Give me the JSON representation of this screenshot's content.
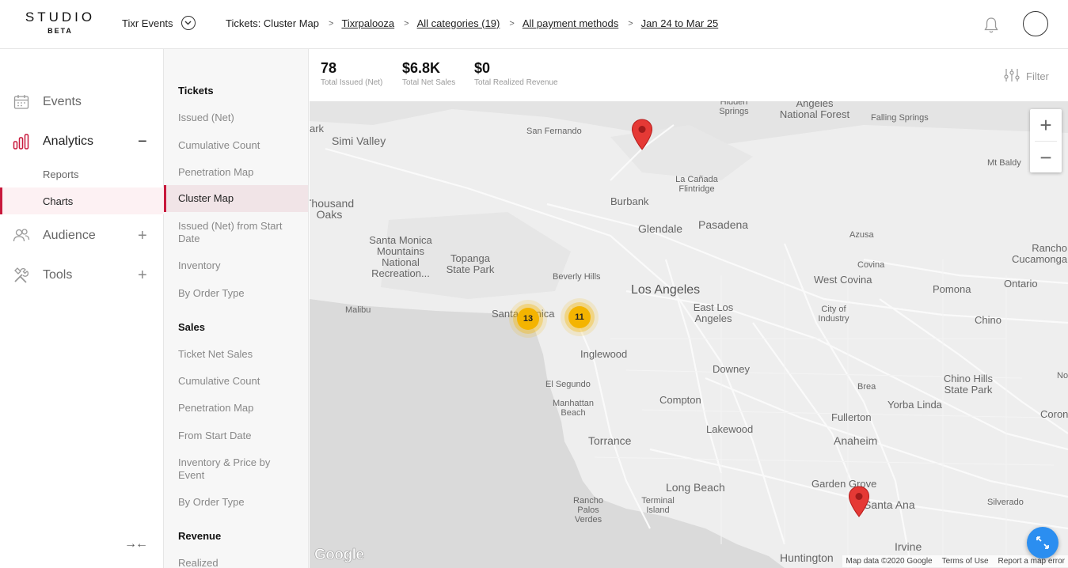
{
  "logo": {
    "main": "STUDIO",
    "sub": "BETA"
  },
  "org": {
    "name": "Tixr Events"
  },
  "breadcrumbs": {
    "current": "Tickets: Cluster Map",
    "links": [
      "Tixrpalooza",
      "All categories (19)",
      "All payment methods",
      "Jan 24 to Mar 25"
    ],
    "separator": ">"
  },
  "leftnav": {
    "events": "Events",
    "analytics": "Analytics",
    "analytics_toggle": "−",
    "reports": "Reports",
    "charts": "Charts",
    "audience": "Audience",
    "audience_toggle": "+",
    "tools": "Tools",
    "tools_toggle": "+",
    "collapse": "→←"
  },
  "midnav": {
    "tickets_heading": "Tickets",
    "tickets": [
      "Issued (Net)",
      "Cumulative Count",
      "Penetration Map",
      "Cluster Map",
      "Issued (Net) from Start Date",
      "Inventory",
      "By Order Type"
    ],
    "sales_heading": "Sales",
    "sales": [
      "Ticket Net Sales",
      "Cumulative Count",
      "Penetration Map",
      "From Start Date",
      "Inventory & Price by Event",
      "By Order Type"
    ],
    "revenue_heading": "Revenue",
    "revenue": [
      "Realized"
    ]
  },
  "stats": [
    {
      "value": "78",
      "label": "Total Issued (Net)"
    },
    {
      "value": "$6.8K",
      "label": "Total Net Sales"
    },
    {
      "value": "$0",
      "label": "Total Realized Revenue"
    }
  ],
  "filter": {
    "label": "Filter"
  },
  "map": {
    "places": [
      "Simi Valley",
      "San Fernando",
      "Hidden Springs",
      "Angeles National Forest",
      "Falling Springs",
      "Mt Baldy",
      "La Cañada Flintridge",
      "Burbank",
      "Glendale",
      "Pasadena",
      "Azusa",
      "Rancho Cucamonga",
      "Thousand Oaks",
      "Santa Monica Mountains National Recreation...",
      "Topanga State Park",
      "Covina",
      "West Covina",
      "Pomona",
      "Ontario",
      "Beverly Hills",
      "Los Angeles",
      "East Los Angeles",
      "City of Industry",
      "Malibu",
      "Santa Monica",
      "Chino",
      "Inglewood",
      "Downey",
      "El Segundo",
      "Manhattan Beach",
      "Brea",
      "Chino Hills State Park",
      "Compton",
      "Yorba Linda",
      "Fullerton",
      "Torrance",
      "Lakewood",
      "Anaheim",
      "Long Beach",
      "Garden Grove",
      "Santa Ana",
      "Silverado",
      "Rancho Palos Verdes",
      "Terminal Island",
      "Irvine",
      "Huntington",
      "ark",
      "No",
      "Coron"
    ],
    "clusters": [
      "13",
      "11"
    ],
    "zoom_in": "+",
    "zoom_out": "−",
    "google": "Google",
    "attribution": [
      "Map data ©2020 Google",
      "Terms of Use",
      "Report a map error"
    ]
  }
}
